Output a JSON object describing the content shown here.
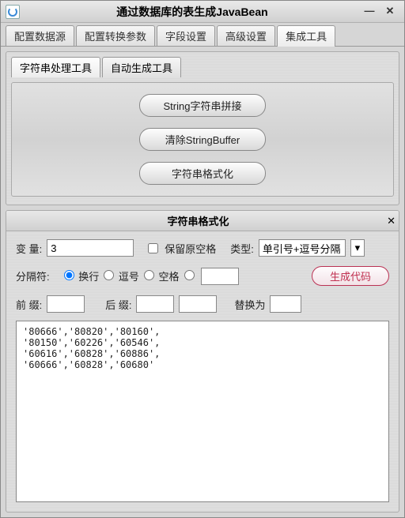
{
  "window": {
    "title": "通过数据库的表生成JavaBean",
    "minimize": "—",
    "close": "✕"
  },
  "tabs": {
    "t1": "配置数据源",
    "t2": "配置转换参数",
    "t3": "字段设置",
    "t4": "高级设置",
    "t5": "集成工具"
  },
  "subtabs": {
    "s1": "字符串处理工具",
    "s2": "自动生成工具"
  },
  "buttons": {
    "concat": "String字符串拼接",
    "clearbuf": "清除StringBuffer",
    "format": "字符串格式化"
  },
  "subwin": {
    "title": "字符串格式化",
    "close": "✕"
  },
  "form": {
    "var_label": "变  量:",
    "var_value": "3",
    "keep_spaces_label": "保留原空格",
    "type_label": "类型:",
    "type_value": "单引号+逗号分隔",
    "delim_label": "分隔符:",
    "opt_newline": "换行",
    "opt_comma": "逗号",
    "opt_space": "空格",
    "opt_custom_value": "",
    "gen_label": "生成代码",
    "prefix_label": "前  缀:",
    "prefix_value": "",
    "suffix_label": "后  缀:",
    "suffix_value": "",
    "replace_label": "替换为",
    "replace_value": ""
  },
  "output": "'80666','80820','80160',\n'80150','60226','60546',\n'60616','60828','60886',\n'60666','60828','60680'"
}
